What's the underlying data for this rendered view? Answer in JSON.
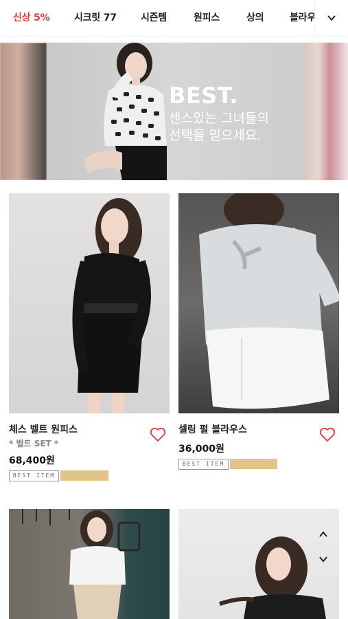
{
  "nav": {
    "items": [
      "신상 5%",
      "시크릿 77",
      "시즌템",
      "원피스",
      "상의",
      "블라우스"
    ],
    "active_index": 0,
    "active_color": "#e8383d",
    "toggle_icon": "chevron-down-icon"
  },
  "banner": {
    "title": "BEST.",
    "subtitle_line1": "센스있는 그녀들의",
    "subtitle_line2": "선택을 믿으세요."
  },
  "products": [
    {
      "name": "체스 벨트 원피스",
      "sub": "* 벨트 SET *",
      "price": "68,400원",
      "badge": "BEST ITEM",
      "swatch_color": "#e2c48a",
      "wish_icon": "heart-outline-icon"
    },
    {
      "name": "셀링 펄 블라우스",
      "sub": "",
      "price": "36,000원",
      "badge": "BEST ITEM",
      "swatch_color": "#e2c48a",
      "wish_icon": "heart-outline-icon"
    }
  ],
  "scroll_controls": {
    "up_icon": "chevron-up-icon",
    "down_icon": "chevron-down-icon"
  }
}
